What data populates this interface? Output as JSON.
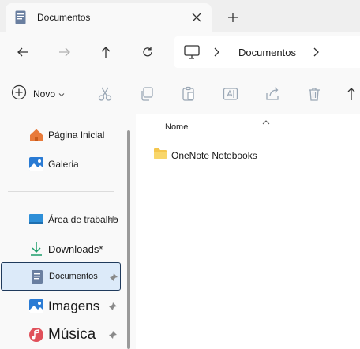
{
  "tab": {
    "title": "Documentos"
  },
  "address": {
    "crumb": "Documentos"
  },
  "toolbar": {
    "new_label": "Novo"
  },
  "sidebar": {
    "items": [
      {
        "label": "Página Inicial"
      },
      {
        "label": "Galeria"
      },
      {
        "label": "Área de trabalho"
      },
      {
        "label": "Downloads*"
      },
      {
        "label": "Documentos"
      },
      {
        "label": "Imagens"
      },
      {
        "label": "Música"
      }
    ]
  },
  "content": {
    "column_header": "Nome",
    "files": [
      {
        "name": "OneNote Notebooks"
      }
    ]
  },
  "colors": {
    "accent": "#0a64c8",
    "selected_bg": "#dceaf9",
    "folder": "#f4c64e"
  }
}
